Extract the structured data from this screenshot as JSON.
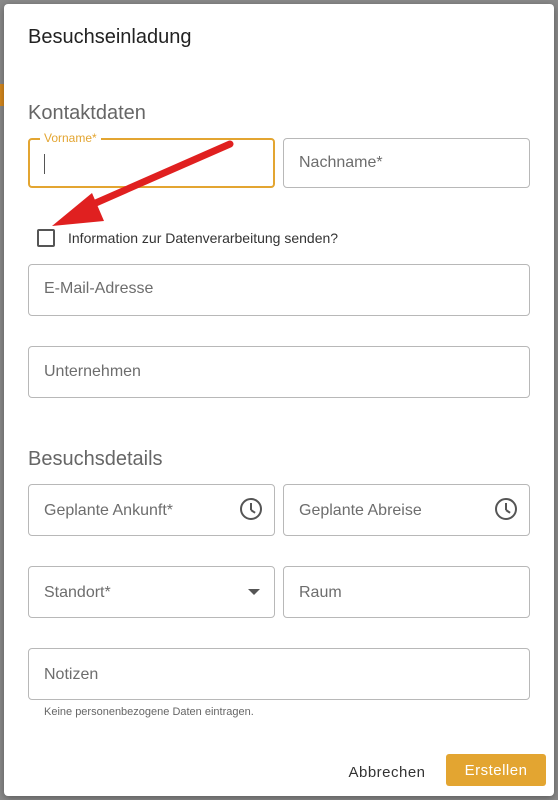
{
  "dialog": {
    "title": "Besuchseinladung"
  },
  "contact": {
    "heading": "Kontaktdaten",
    "firstname": {
      "label": "Vorname*",
      "value": ""
    },
    "lastname": {
      "placeholder": "Nachname*"
    },
    "checkbox_label": "Information zur Datenverarbeitung senden?",
    "email": {
      "placeholder": "E-Mail-Adresse"
    },
    "company": {
      "placeholder": "Unternehmen"
    }
  },
  "visit": {
    "heading": "Besuchsdetails",
    "arrival": {
      "placeholder": "Geplante Ankunft*",
      "icon": "clock-icon"
    },
    "departure": {
      "placeholder": "Geplante Abreise",
      "icon": "clock-icon"
    },
    "location": {
      "placeholder": "Standort*",
      "icon": "chevron-down-icon"
    },
    "room": {
      "placeholder": "Raum"
    },
    "notes": {
      "placeholder": "Notizen",
      "hint": "Keine personenbezogene Daten eintragen."
    }
  },
  "actions": {
    "cancel_label": "Abbrechen",
    "create_label": "Erstellen"
  },
  "colors": {
    "accent": "#e3a531",
    "annotation_arrow": "#e02020"
  }
}
